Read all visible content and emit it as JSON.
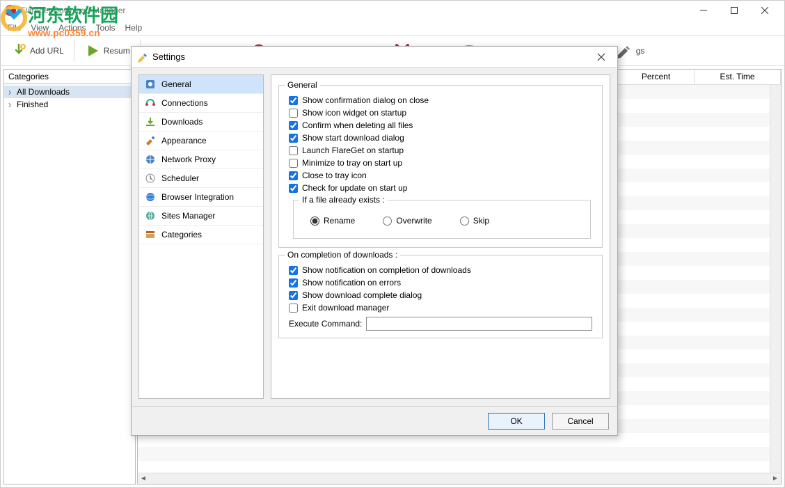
{
  "window": {
    "title": "Flareget Download Manager",
    "menu": [
      "File",
      "View",
      "Actions",
      "Tools",
      "Help"
    ]
  },
  "watermark": {
    "text": "河东软件园",
    "url": "www.pc0359.cn"
  },
  "toolbar": {
    "add_url": "Add URL",
    "resume": "Resum"
  },
  "sidebar": {
    "header": "Categories",
    "items": [
      "All Downloads",
      "Finished"
    ]
  },
  "columns": {
    "percent": "Percent",
    "est_time": "Est. Time"
  },
  "dialog": {
    "title": "Settings",
    "nav": [
      {
        "label": "General"
      },
      {
        "label": "Connections"
      },
      {
        "label": "Downloads"
      },
      {
        "label": "Appearance"
      },
      {
        "label": "Network Proxy"
      },
      {
        "label": "Scheduler"
      },
      {
        "label": "Browser Integration"
      },
      {
        "label": "Sites Manager"
      },
      {
        "label": "Categories"
      }
    ],
    "general": {
      "group1_title": "General",
      "cb1": "Show confirmation dialog on close",
      "cb2": "Show icon widget on startup",
      "cb3": "Confirm when deleting all files",
      "cb4": "Show start download dialog",
      "cb5": "Launch FlareGet on startup",
      "cb6": "Minimize to tray on start up",
      "cb7": "Close to tray icon",
      "cb8": "Check for update on start up",
      "file_exists_title": "If a file already exists :",
      "radio_rename": "Rename",
      "radio_overwrite": "Overwrite",
      "radio_skip": "Skip",
      "group2_title": "On completion of downloads :",
      "cb9": "Show notification on completion of downloads",
      "cb10": "Show notification on errors",
      "cb11": "Show download complete dialog",
      "cb12": "Exit download manager",
      "exec_label": "Execute Command:"
    },
    "ok": "OK",
    "cancel": "Cancel"
  }
}
